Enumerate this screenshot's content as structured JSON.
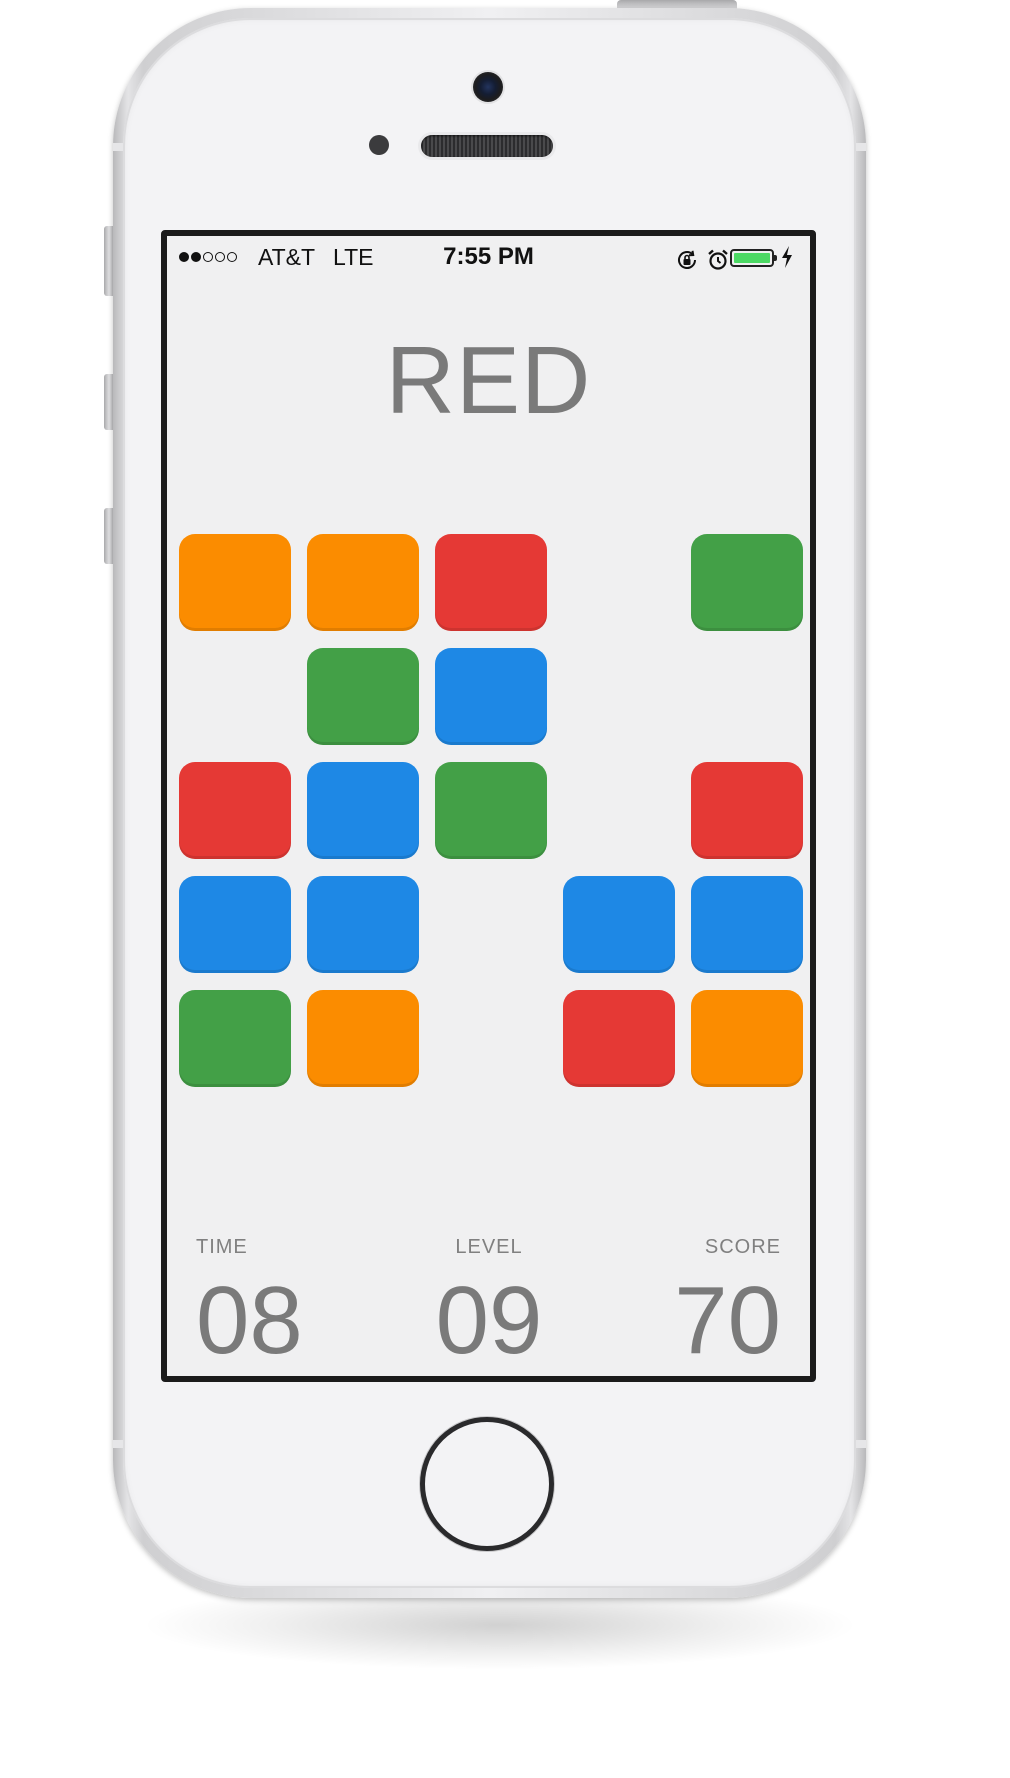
{
  "status_bar": {
    "signal_strength": 2,
    "signal_dots": 5,
    "carrier": "AT&T",
    "network": "LTE",
    "time": "7:55 PM",
    "icons": [
      "rotation-lock-icon",
      "alarm-icon",
      "battery-icon",
      "charging-bolt-icon"
    ],
    "battery_level": 1.0
  },
  "game": {
    "target_word": "RED",
    "grid_columns": 5,
    "grid_rows": 5,
    "tiles": [
      [
        "orange",
        "orange",
        "red",
        null,
        "green"
      ],
      [
        null,
        "green",
        "blue",
        null,
        null
      ],
      [
        "red",
        "blue",
        "green",
        null,
        "red"
      ],
      [
        "blue",
        "blue",
        null,
        "blue",
        "blue"
      ],
      [
        "green",
        "orange",
        null,
        "red",
        "orange"
      ]
    ]
  },
  "colors": {
    "orange": "#fb8c00",
    "red": "#e53935",
    "green": "#43a047",
    "blue": "#1e88e5",
    "battery": "#4cd964",
    "text_gray": "#7a7a7a",
    "screen_bg": "#f0f0f1"
  },
  "stats": {
    "time": {
      "label": "TIME",
      "value": "08"
    },
    "level": {
      "label": "LEVEL",
      "value": "09"
    },
    "score": {
      "label": "SCORE",
      "value": "70"
    }
  }
}
